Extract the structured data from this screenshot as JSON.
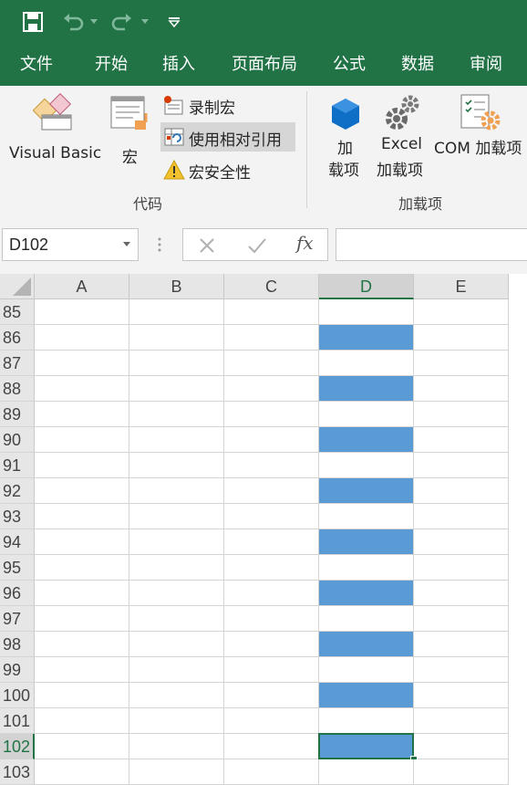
{
  "quick_access": {
    "icons": [
      "save-icon",
      "undo-icon",
      "redo-icon",
      "customize-qat-icon"
    ]
  },
  "tabs": [
    {
      "label": "文件"
    },
    {
      "label": "开始"
    },
    {
      "label": "插入"
    },
    {
      "label": "页面布局"
    },
    {
      "label": "公式"
    },
    {
      "label": "数据"
    },
    {
      "label": "审阅"
    }
  ],
  "ribbon": {
    "code_group": {
      "visual_basic": "Visual Basic",
      "macro": "宏",
      "record_macro": "录制宏",
      "relative_ref": "使用相对引用",
      "macro_security": "宏安全性",
      "label": "代码"
    },
    "addins_group": {
      "addin_line1": "加",
      "addin_line2": "载项",
      "excel_line1": "Excel",
      "excel_line2": "加载项",
      "com": "COM 加载项",
      "label": "加载项"
    }
  },
  "formula_bar": {
    "name_box": "D102",
    "fx_symbol": "fx",
    "formula": ""
  },
  "sheet": {
    "columns": [
      "A",
      "B",
      "C",
      "D",
      "E"
    ],
    "selected_column": "D",
    "selected_row": "102",
    "rows": [
      {
        "num": "85",
        "d_filled": false
      },
      {
        "num": "86",
        "d_filled": true
      },
      {
        "num": "87",
        "d_filled": false
      },
      {
        "num": "88",
        "d_filled": true
      },
      {
        "num": "89",
        "d_filled": false
      },
      {
        "num": "90",
        "d_filled": true
      },
      {
        "num": "91",
        "d_filled": false
      },
      {
        "num": "92",
        "d_filled": true
      },
      {
        "num": "93",
        "d_filled": false
      },
      {
        "num": "94",
        "d_filled": true
      },
      {
        "num": "95",
        "d_filled": false
      },
      {
        "num": "96",
        "d_filled": true
      },
      {
        "num": "97",
        "d_filled": false
      },
      {
        "num": "98",
        "d_filled": true
      },
      {
        "num": "99",
        "d_filled": false
      },
      {
        "num": "100",
        "d_filled": true
      },
      {
        "num": "101",
        "d_filled": false
      },
      {
        "num": "102",
        "d_filled": true
      },
      {
        "num": "103",
        "d_filled": false
      }
    ]
  },
  "colors": {
    "excel_green": "#217346",
    "fill_blue": "#5b9bd5",
    "ribbon_bg": "#f3f3f3"
  }
}
